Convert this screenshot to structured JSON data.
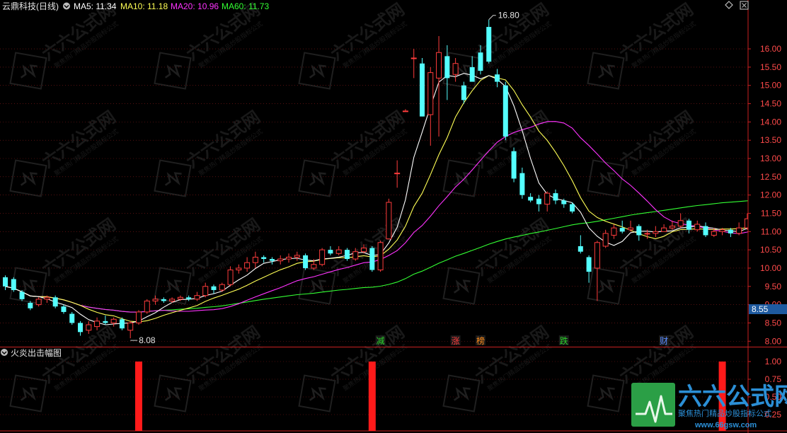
{
  "header": {
    "stock_name": "云鼎科技(日线)",
    "ma5_label": "MA5: 11.34",
    "ma10_label": "MA10: 11.18",
    "ma20_label": "MA20: 10.96",
    "ma60_label": "MA60: 11.73"
  },
  "sub_panel": {
    "title": "火炎出击幅图",
    "ticks": [
      "1.00",
      "0.75",
      "0.50",
      "0.25"
    ]
  },
  "annotations": {
    "high_label": "16.80",
    "low_label": "8.08",
    "current_price": "8.55"
  },
  "events": [
    {
      "label": "减",
      "color": "#2bd42b",
      "bar": 45
    },
    {
      "label": "涨",
      "color": "#ff3c3c",
      "bar": 54
    },
    {
      "label": "榜",
      "color": "#ff8c1a",
      "bar": 57
    },
    {
      "label": "跌",
      "color": "#2bd42b",
      "bar": 67
    },
    {
      "label": "财",
      "color": "#5a8cff",
      "bar": 79
    }
  ],
  "watermark": {
    "logo_text": "六六公式网",
    "slogan": "聚焦热门精品炒股指标公式",
    "url": "www.66gsw.com"
  },
  "colors": {
    "up": "#ff3c3c",
    "down": "#54ffff",
    "ma5": "#ffffff",
    "ma10": "#ffff55",
    "ma20": "#ff33ff",
    "ma60": "#33ff33",
    "axis": "#c82020"
  },
  "chart_data": {
    "type": "candlestick",
    "y_axis_ticks": [
      16.0,
      15.5,
      15.0,
      14.5,
      14.0,
      13.5,
      13.0,
      12.5,
      12.0,
      11.5,
      11.0,
      10.5,
      10.0,
      9.5,
      9.0,
      8.5,
      8.0
    ],
    "ylim": [
      7.85,
      16.95
    ],
    "candles": [
      [
        9.75,
        9.5,
        9.8,
        9.4
      ],
      [
        9.7,
        9.4,
        9.75,
        9.35
      ],
      [
        9.35,
        9.15,
        9.4,
        9.1
      ],
      [
        9.05,
        8.9,
        9.1,
        8.85
      ],
      [
        9.0,
        9.15,
        9.2,
        8.95
      ],
      [
        9.15,
        9.2,
        9.25,
        9.05
      ],
      [
        9.2,
        8.95,
        9.25,
        8.9
      ],
      [
        8.95,
        8.8,
        9.0,
        8.75
      ],
      [
        8.75,
        8.5,
        8.8,
        8.45
      ],
      [
        8.5,
        8.25,
        8.55,
        8.15
      ],
      [
        8.3,
        8.45,
        8.55,
        8.2
      ],
      [
        8.4,
        8.55,
        8.65,
        8.3
      ],
      [
        8.55,
        8.5,
        8.7,
        8.45
      ],
      [
        8.5,
        8.6,
        8.65,
        8.4
      ],
      [
        8.6,
        8.35,
        8.65,
        8.3
      ],
      [
        8.3,
        8.5,
        8.55,
        8.08
      ],
      [
        8.5,
        8.8,
        8.85,
        8.45
      ],
      [
        8.8,
        9.1,
        9.15,
        8.75
      ],
      [
        9.1,
        9.15,
        9.25,
        9.0
      ],
      [
        9.15,
        9.1,
        9.2,
        9.05
      ],
      [
        9.1,
        9.15,
        9.2,
        9.05
      ],
      [
        9.15,
        9.2,
        9.25,
        9.1
      ],
      [
        9.2,
        9.15,
        9.25,
        9.1
      ],
      [
        9.15,
        9.25,
        9.35,
        9.1
      ],
      [
        9.25,
        9.5,
        9.6,
        9.2
      ],
      [
        9.5,
        9.4,
        9.55,
        9.3
      ],
      [
        9.4,
        9.55,
        9.6,
        9.35
      ],
      [
        9.55,
        9.95,
        10.05,
        9.5
      ],
      [
        9.95,
        10.0,
        10.1,
        9.85
      ],
      [
        10.0,
        10.15,
        10.3,
        9.9
      ],
      [
        10.15,
        10.3,
        10.45,
        10.0
      ],
      [
        10.3,
        10.25,
        10.35,
        10.15
      ],
      [
        10.25,
        10.2,
        10.3,
        10.1
      ],
      [
        10.2,
        10.25,
        10.35,
        10.1
      ],
      [
        10.25,
        10.3,
        10.4,
        10.15
      ],
      [
        10.3,
        10.35,
        10.45,
        10.2
      ],
      [
        10.35,
        10.0,
        10.4,
        9.95
      ],
      [
        10.0,
        10.1,
        10.25,
        9.95
      ],
      [
        10.1,
        10.5,
        10.55,
        10.05
      ],
      [
        10.5,
        10.4,
        10.6,
        10.35
      ],
      [
        10.4,
        10.5,
        10.6,
        10.35
      ],
      [
        10.5,
        10.25,
        10.55,
        10.2
      ],
      [
        10.25,
        10.45,
        10.55,
        10.2
      ],
      [
        10.45,
        10.55,
        10.65,
        10.4
      ],
      [
        10.55,
        9.95,
        10.6,
        9.9
      ],
      [
        9.95,
        10.7,
        10.75,
        9.9
      ],
      [
        10.8,
        11.8,
        11.9,
        10.8
      ],
      [
        12.6,
        12.6,
        12.95,
        12.2
      ],
      [
        14.3,
        14.3,
        14.35,
        14.3
      ],
      [
        15.75,
        15.75,
        16.0,
        15.2
      ],
      [
        15.6,
        14.15,
        15.75,
        14.15
      ],
      [
        14.2,
        15.35,
        15.5,
        13.35
      ],
      [
        15.2,
        15.9,
        16.35,
        13.6
      ],
      [
        15.8,
        15.2,
        16.1,
        14.6
      ],
      [
        15.3,
        15.6,
        15.75,
        15.1
      ],
      [
        15.0,
        14.6,
        15.1,
        14.5
      ],
      [
        15.5,
        15.1,
        15.8,
        15.4
      ],
      [
        15.9,
        15.4,
        16.1,
        15.3
      ],
      [
        16.6,
        15.65,
        16.8,
        15.6
      ],
      [
        15.3,
        15.1,
        15.45,
        14.95
      ],
      [
        15.0,
        13.6,
        15.1,
        13.5
      ],
      [
        13.2,
        12.45,
        13.3,
        12.35
      ],
      [
        12.6,
        12.0,
        12.75,
        11.9
      ],
      [
        11.95,
        11.85,
        12.05,
        11.8
      ],
      [
        11.9,
        11.75,
        12.0,
        11.55
      ],
      [
        11.75,
        12.05,
        12.1,
        11.55
      ],
      [
        12.05,
        11.85,
        12.15,
        11.75
      ],
      [
        11.85,
        11.75,
        11.9,
        11.65
      ],
      [
        11.75,
        11.55,
        11.8,
        11.5
      ],
      [
        10.6,
        10.45,
        10.9,
        10.4
      ],
      [
        10.3,
        9.9,
        10.35,
        9.6
      ],
      [
        10.0,
        10.7,
        10.75,
        9.1
      ],
      [
        10.6,
        10.95,
        11.05,
        10.55
      ],
      [
        10.9,
        11.1,
        11.2,
        10.8
      ],
      [
        11.1,
        11.0,
        11.3,
        10.95
      ],
      [
        11.05,
        11.1,
        11.3,
        11.0
      ],
      [
        11.15,
        10.9,
        11.2,
        10.75
      ],
      [
        10.95,
        10.95,
        11.05,
        10.8
      ],
      [
        10.95,
        11.0,
        11.15,
        10.85
      ],
      [
        11.0,
        11.1,
        11.2,
        11.0
      ],
      [
        11.1,
        11.15,
        11.3,
        11.05
      ],
      [
        11.15,
        11.3,
        11.5,
        11.1
      ],
      [
        11.3,
        11.05,
        11.35,
        10.95
      ],
      [
        11.05,
        11.2,
        11.3,
        11.0
      ],
      [
        11.15,
        10.9,
        11.25,
        10.85
      ],
      [
        10.9,
        11.0,
        11.1,
        10.85
      ],
      [
        11.0,
        11.05,
        11.1,
        10.9
      ],
      [
        11.05,
        10.95,
        11.1,
        10.85
      ],
      [
        10.95,
        11.1,
        11.25,
        10.9
      ],
      [
        11.1,
        11.35,
        11.5,
        11.05
      ],
      [
        11.5,
        11.75,
        11.85,
        11.4
      ],
      [
        11.75,
        11.55,
        11.85,
        11.45
      ]
    ],
    "signal_bars": [
      16,
      44,
      86
    ]
  }
}
